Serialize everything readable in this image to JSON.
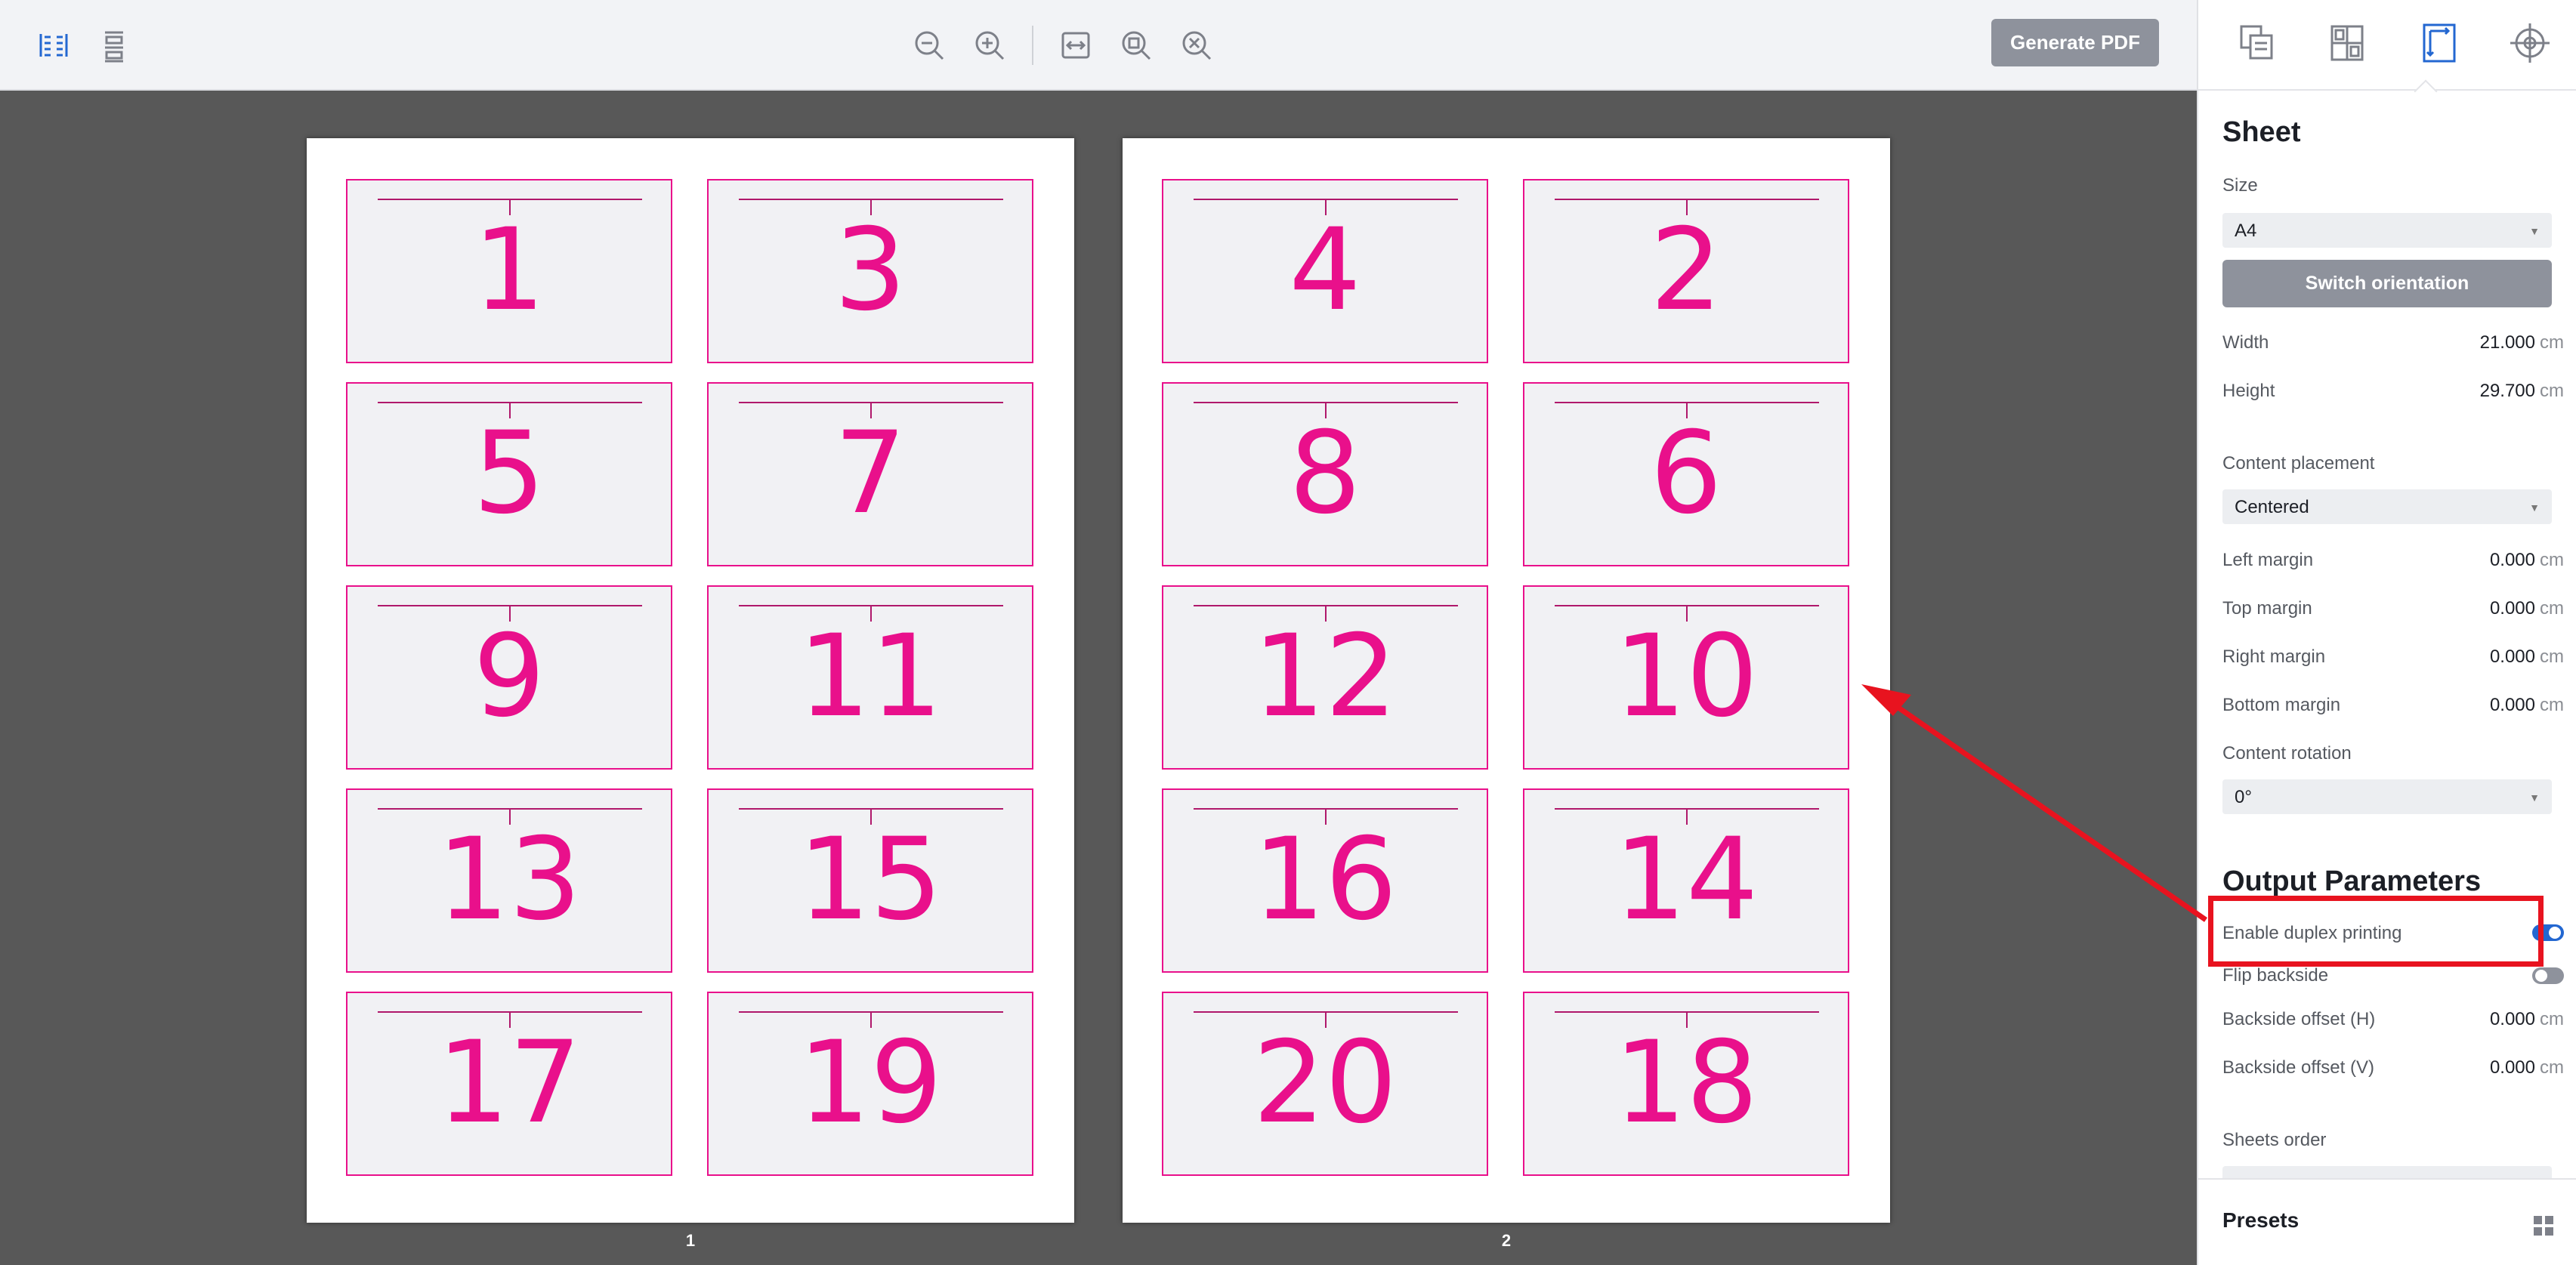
{
  "toolbar": {
    "left_icons": [
      "spread-view-icon",
      "single-view-icon"
    ],
    "zoom_icons": [
      "zoom-out-icon",
      "zoom-in-icon",
      "fit-width-icon",
      "fit-page-icon",
      "zoom-reset-icon"
    ],
    "generate_pdf_label": "Generate PDF"
  },
  "sheets": [
    {
      "label": "1",
      "cards": [
        "1",
        "3",
        "5",
        "7",
        "9",
        "11",
        "13",
        "15",
        "17",
        "19"
      ]
    },
    {
      "label": "2",
      "cards": [
        "4",
        "2",
        "8",
        "6",
        "12",
        "10",
        "16",
        "14",
        "20",
        "18"
      ]
    }
  ],
  "panel": {
    "tabs": [
      "pages-icon",
      "layout-icon",
      "sheet-icon",
      "marks-icon"
    ],
    "active_tab": "sheet-icon",
    "sheet_title": "Sheet",
    "size_label": "Size",
    "size_value": "A4",
    "switch_orientation_label": "Switch orientation",
    "width_label": "Width",
    "width_value": "21.000",
    "height_label": "Height",
    "height_value": "29.700",
    "unit": "cm",
    "content_placement_label": "Content placement",
    "content_placement_value": "Centered",
    "left_margin_label": "Left margin",
    "left_margin_value": "0.000",
    "top_margin_label": "Top margin",
    "top_margin_value": "0.000",
    "right_margin_label": "Right margin",
    "right_margin_value": "0.000",
    "bottom_margin_label": "Bottom margin",
    "bottom_margin_value": "0.000",
    "content_rotation_label": "Content rotation",
    "content_rotation_value": "0°",
    "output_title": "Output Parameters",
    "duplex_label": "Enable duplex printing",
    "duplex_enabled": true,
    "flip_label": "Flip backside",
    "flip_enabled": false,
    "backside_h_label": "Backside offset (H)",
    "backside_h_value": "0.000",
    "backside_v_label": "Backside offset (V)",
    "backside_v_value": "0.000",
    "sheets_order_label": "Sheets order",
    "presets_label": "Presets"
  },
  "colors": {
    "accent": "#2367d1",
    "card_magenta": "#e9108b",
    "annotation_red": "#e8131f",
    "button_gray": "#8e929c"
  }
}
